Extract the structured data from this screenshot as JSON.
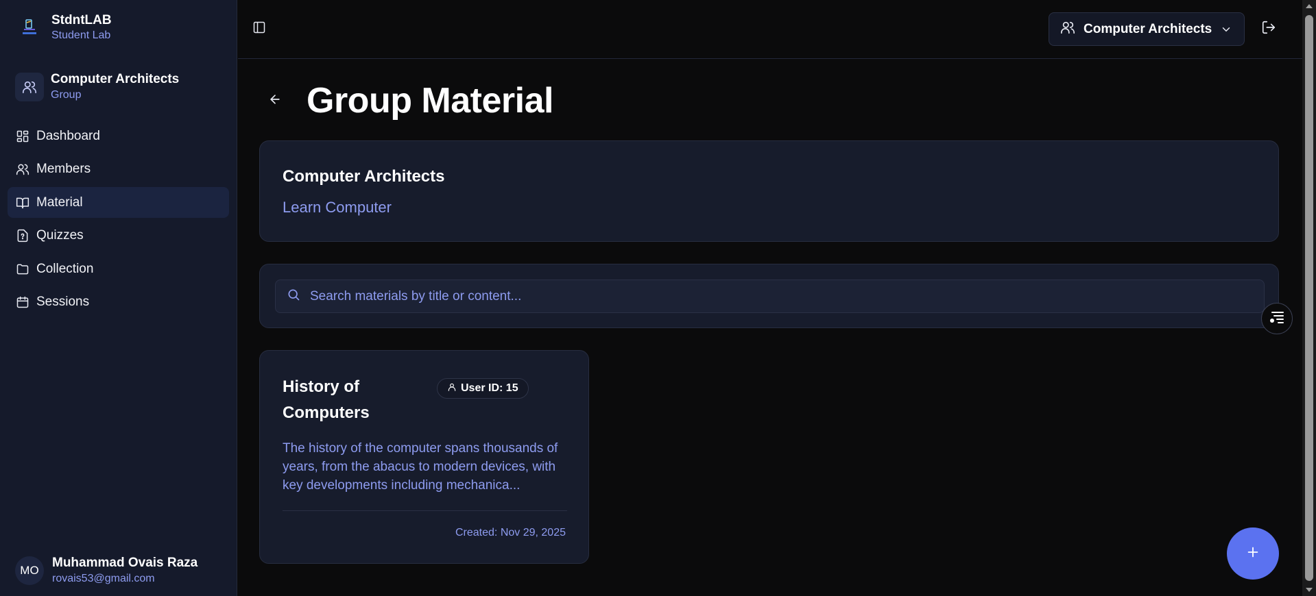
{
  "brand": {
    "title": "StdntLAB",
    "subtitle": "Student Lab"
  },
  "group": {
    "title": "Computer Architects",
    "subtitle": "Group"
  },
  "sidebar": {
    "items": [
      {
        "label": "Dashboard",
        "icon": "dashboard-icon"
      },
      {
        "label": "Members",
        "icon": "users-icon"
      },
      {
        "label": "Material",
        "icon": "book-open-icon",
        "active": true
      },
      {
        "label": "Quizzes",
        "icon": "quiz-icon"
      },
      {
        "label": "Collection",
        "icon": "folder-icon"
      },
      {
        "label": "Sessions",
        "icon": "calendar-icon"
      }
    ]
  },
  "user": {
    "initials": "MO",
    "name": "Muhammad Ovais Raza",
    "email": "rovais53@gmail.com"
  },
  "topbar": {
    "group_selector": "Computer Architects"
  },
  "page": {
    "title": "Group Material"
  },
  "info": {
    "title": "Computer Architects",
    "description": "Learn Computer"
  },
  "search": {
    "placeholder": "Search materials by title or content..."
  },
  "materials": [
    {
      "title": "History of Computers",
      "badge": "User ID: 15",
      "description": "The history of the computer spans thousands of years, from the abacus to modern devices, with key developments including mechanica...",
      "created": "Created: Nov 29, 2025"
    }
  ],
  "colors": {
    "accent": "#5b72f0",
    "muted_text": "#8e9cf0",
    "sidebar_bg": "#151a2b",
    "card_bg": "#171c2c",
    "page_bg": "#0b0b0c"
  }
}
